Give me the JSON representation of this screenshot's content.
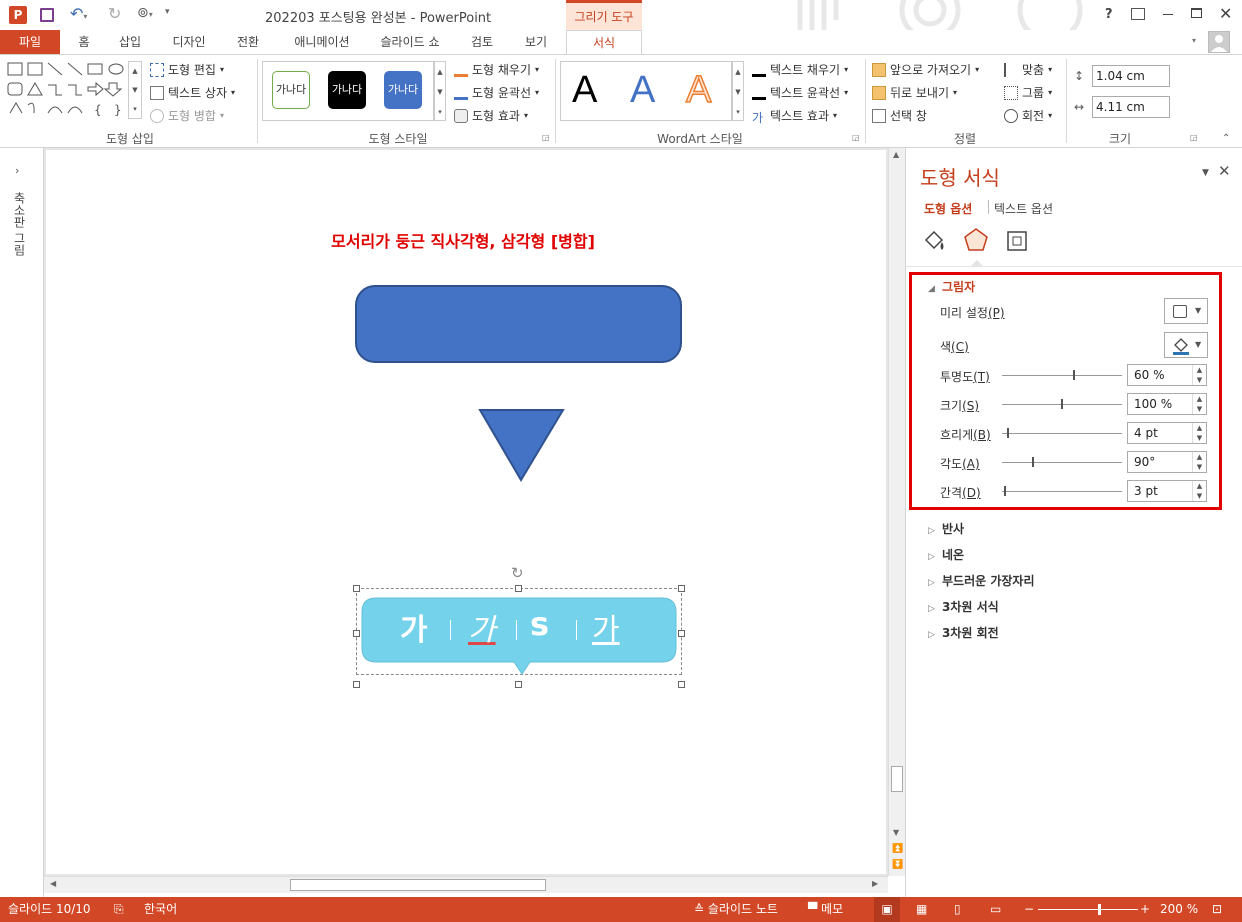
{
  "titlebar": {
    "title": "202203 포스팅용 완성본 - PowerPoint",
    "tools_label": "그리기 도구",
    "help": "?",
    "app_icon": "P"
  },
  "tabs": [
    "파일",
    "홈",
    "삽입",
    "디자인",
    "전환",
    "애니메이션",
    "슬라이드 쇼",
    "검토",
    "보기",
    "서식"
  ],
  "ribbon": {
    "edit_shape": "도형 편집",
    "text_box": "텍스트 상자",
    "merge_shapes": "도형 병합",
    "group_insert": "도형 삽입",
    "style_samples": [
      "가나다",
      "가나다",
      "가나다"
    ],
    "shape_fill": "도형 채우기",
    "shape_outline": "도형 윤곽선",
    "shape_effect": "도형 효과",
    "group_style": "도형 스타일",
    "wordart_letters": [
      "A",
      "A",
      "A"
    ],
    "text_fill": "텍스트 채우기",
    "text_outline": "텍스트 윤곽선",
    "text_effect": "텍스트 효과",
    "group_wordart": "WordArt 스타일",
    "bring_forward": "앞으로 가져오기",
    "send_backward": "뒤로 보내기",
    "selection_pane": "선택 창",
    "align": "맞춤",
    "group": "그룹",
    "rotate": "회전",
    "group_arrange": "정렬",
    "height": "1.04 cm",
    "width": "4.11 cm",
    "group_size": "크기"
  },
  "left_strip": {
    "label": "축소판 그림"
  },
  "slide": {
    "heading": "모서리가 둥근 직사각형, 삼각형 [병합]",
    "callout_chars": [
      "가",
      "가",
      "s",
      "가"
    ],
    "colors": {
      "rect": "#4472c4",
      "callout": "#74d2ea",
      "heading": "#e00000"
    }
  },
  "pane": {
    "title": "도형 서식",
    "tab_shape": "도형 옵션",
    "tab_text": "텍스트 옵션",
    "section_shadow": "그림자",
    "preset_label": "미리 설정",
    "preset_key": "(P)",
    "color_label": "색",
    "color_key": "(C)",
    "rows": [
      {
        "label": "투명도",
        "key": "(T)",
        "value": "60 %",
        "level": 0.6
      },
      {
        "label": "크기",
        "key": "(S)",
        "value": "100 %",
        "level": 0.5
      },
      {
        "label": "흐리게",
        "key": "(B)",
        "value": "4 pt",
        "level": 0.04
      },
      {
        "label": "각도",
        "key": "(A)",
        "value": "90°",
        "level": 0.25
      },
      {
        "label": "간격",
        "key": "(D)",
        "value": "3 pt",
        "level": 0.02
      }
    ],
    "sections": [
      "반사",
      "네온",
      "부드러운 가장자리",
      "3차원 서식",
      "3차원 회전"
    ]
  },
  "statusbar": {
    "slide_count": "슬라이드 10/10",
    "language": "한국어",
    "notes": "슬라이드 노트",
    "comments": "메모",
    "zoom": "200 %"
  }
}
